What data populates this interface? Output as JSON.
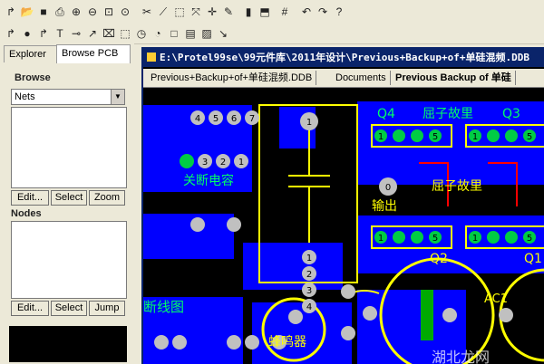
{
  "toolbar1": {
    "icons": [
      "wire-icon",
      "open-icon",
      "save-icon",
      "print-icon",
      "zoom-in-icon",
      "zoom-out-icon",
      "zoom-fit-icon",
      "zoom-area-icon",
      "cut-icon",
      "line-icon",
      "select-area-icon",
      "move-icon",
      "cross-icon",
      "pencil-icon",
      "rules-icon",
      "component-icon",
      "grid-icon",
      "undo-icon",
      "redo-icon",
      "help-icon"
    ],
    "glyphs": [
      "↱",
      "📂",
      "■",
      "⎙",
      "⊕",
      "⊖",
      "⊡",
      "⊙",
      "✂",
      "⟋",
      "⬚",
      "⤧",
      "✛",
      "✎",
      "▮",
      "⬒",
      "#",
      "↶",
      "↷",
      "?"
    ]
  },
  "toolbar2": {
    "glyphs": [
      "↱",
      "●",
      "↱",
      "T",
      "⊸",
      "↗",
      "⌧",
      "⬚",
      "◷",
      "◔",
      "□",
      "▤",
      "▨",
      "↘"
    ]
  },
  "panel": {
    "tabs": [
      "Explorer",
      "Browse PCB"
    ],
    "browse_title": "Browse",
    "browse_select": "Nets",
    "browse_buttons": [
      "Edit...",
      "Select",
      "Zoom"
    ],
    "nodes_title": "Nodes",
    "nodes_buttons": [
      "Edit...",
      "Select",
      "Jump"
    ]
  },
  "window": {
    "title": "E:\\Protel99se\\99元件库\\2011年设计\\Previous+Backup+of+单硅混频.DDB",
    "tabs": [
      "Previous+Backup+of+单硅混频.DDB",
      "Documents",
      "Previous Backup of 单硅"
    ]
  },
  "pcb": {
    "labels": {
      "q4": "Q4",
      "q3": "Q3",
      "fault1": "屈子故里",
      "fault2": "屈子故里",
      "shutdown": "关断电容",
      "output": "输出",
      "q2": "Q2",
      "q1": "Q1",
      "breakline": "断线图",
      "buzzer": "蜂鸣器",
      "ac1": "AC1",
      "watermark": "湖北龙网"
    },
    "pads": {
      "top4": [
        "4",
        "5",
        "6",
        "7"
      ],
      "row3": [
        "3",
        "2",
        "1"
      ],
      "vert": [
        "1",
        "2",
        "3",
        "4"
      ],
      "small": [
        "1",
        "5"
      ],
      "zero": "0"
    }
  },
  "colors": {
    "board": "#000000",
    "blue": "#0000ff",
    "yellow": "#ffff00",
    "pad": "#c0c0c0",
    "silk": "#ffff00",
    "green": "#00ff66",
    "red": "#ff0000",
    "titlebar": "#0a246a"
  }
}
